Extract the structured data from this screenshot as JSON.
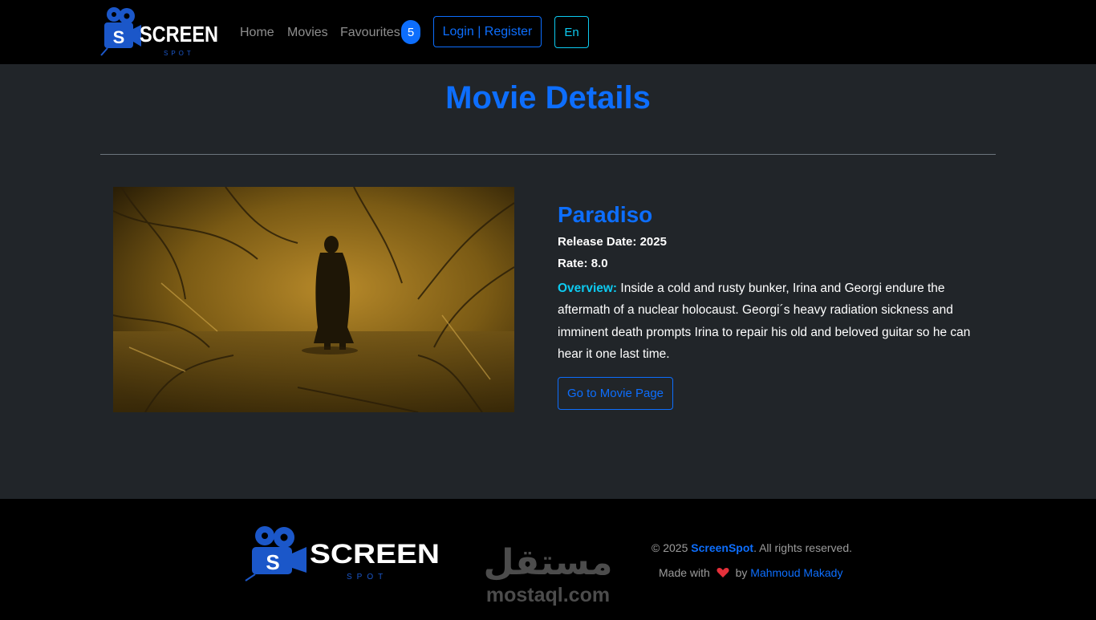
{
  "navbar": {
    "brand": {
      "logo_text": "SCREEN",
      "logo_subtext": "SPOT",
      "badge_letter": "S"
    },
    "links": [
      {
        "label": "Home"
      },
      {
        "label": "Movies"
      },
      {
        "label": "Favourites"
      }
    ],
    "favourites_count": "5",
    "login_label": "Login | Register",
    "language_label": "En"
  },
  "main": {
    "page_title": "Movie Details",
    "movie": {
      "title": "Paradiso",
      "release_label": "Release Date:",
      "release_value": "2025",
      "rate_label": "Rate:",
      "rate_value": "8.0",
      "overview_label": "Overview:",
      "overview_text": "Inside a cold and rusty bunker, Irina and Georgi endure the aftermath of a nuclear holocaust. Georgi´s heavy radiation sickness and imminent death prompts Irina to repair his old and beloved guitar so he can hear it one last time.",
      "button_label": "Go to Movie Page"
    }
  },
  "footer": {
    "copyright_prefix": "© 2025",
    "brand_name": "ScreenSpot",
    "rights_text": ". All rights reserved.",
    "made_with": "Made with",
    "by_text": "by",
    "author": "Mahmoud Makady",
    "watermark_arabic": "مستقل",
    "watermark_latin": "mostaql.com"
  },
  "colors": {
    "primary": "#0d6efd",
    "info": "#0dcaf0",
    "navbar_bg": "#000000",
    "body_bg": "#212529",
    "heart": "#e5303a"
  }
}
